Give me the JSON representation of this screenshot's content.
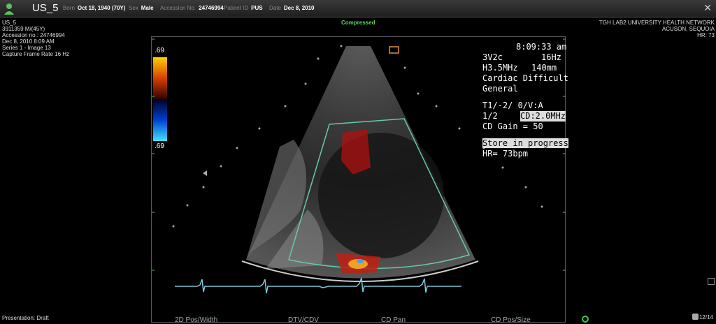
{
  "header": {
    "patient_name": "US_5",
    "born_label": "Born",
    "born_value": "Oct 18, 1940 (70Y)",
    "sex_label": "Sex",
    "sex_value": "Male",
    "accession_label": "Accession No.",
    "accession_value": "24746994",
    "patient_id_label": "Patient ID",
    "patient_id_value": "PUS",
    "date_label": "Date",
    "date_value": "Dec 8, 2010",
    "close": "✕"
  },
  "left_info": [
    "US_5",
    "3911359 M/(45Y)",
    "Accession no.: 24746994",
    "Dec 8, 2010 8:09 AM",
    "Series 1 - Image 13",
    "Capture Frame Rate 16 Hz"
  ],
  "compressed_label": "Compressed",
  "right_info": [
    "TGH LAB2 UNIVERSITY HEALTH NETWORK",
    "ACUSON, SEQUOIA",
    "HR: 73"
  ],
  "overlay": {
    "time": "8:09:33 am",
    "probe": "3V2c",
    "rate": "16Hz",
    "freq": "H3.5MHz",
    "depth": "140mm",
    "preset1": "Cardiac Difficult",
    "preset2": "General",
    "setting": "T1/-2/ 0/V:A",
    "ratio": "1/2",
    "cd_freq": "CD:2.0MHz",
    "cd_gain": "CD Gain = 50",
    "store": "Store in progress",
    "hr": "HR= 73bpm"
  },
  "color_scale": {
    "top": ".69",
    "bottom": ".69"
  },
  "softkeys": [
    "2D Pos/Width",
    "DTV/CDV",
    "CD Pan",
    "CD Pos/Size"
  ],
  "footer": {
    "presentation": "Presentation: Draft",
    "frame_counter": "12/14"
  },
  "colors": {
    "roi": "#66c8b0",
    "ecg": "#7ec6d8",
    "compressed": "#5fd35f"
  }
}
